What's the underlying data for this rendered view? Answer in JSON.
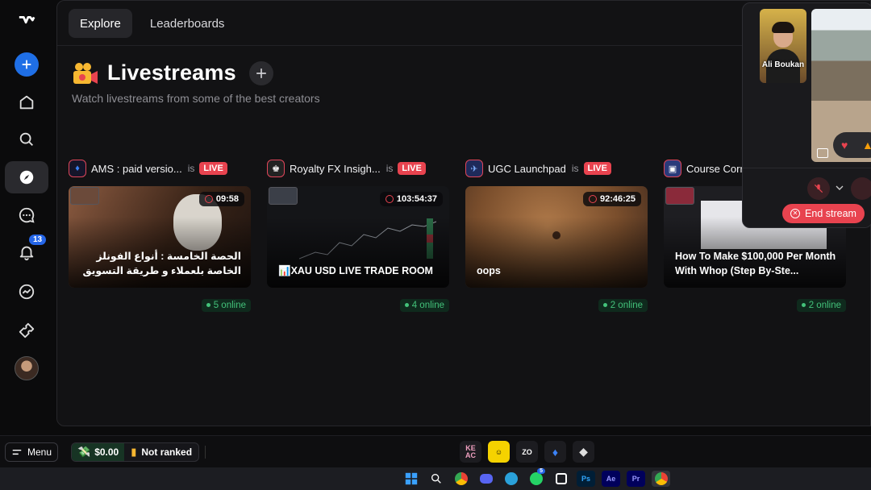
{
  "tabs": [
    {
      "label": "Explore",
      "active": true
    },
    {
      "label": "Leaderboards",
      "active": false
    }
  ],
  "sidebar": {
    "items": [
      "logo-icon",
      "create-icon",
      "home-icon",
      "search-icon",
      "explore-icon",
      "chat-icon",
      "notifications-icon",
      "analytics-icon",
      "tickets-icon",
      "profile-avatar"
    ],
    "notification_count": "13"
  },
  "header": {
    "title": "Livestreams",
    "subtitle": "Watch livestreams from some of the best creators"
  },
  "streams": [
    {
      "channel": "AMS : paid versio...",
      "is": "is",
      "live": "LIVE",
      "duration": "09:58",
      "title": "الحصة الخامسة : أنواع الفونلز الخاصة بلعملاء و طريقة التسويق",
      "online": "5 online",
      "accent": "#6a3f2e"
    },
    {
      "channel": "Royalty FX Insigh...",
      "is": "is",
      "live": "LIVE",
      "duration": "103:54:37",
      "title": "📊XAU USD LIVE TRADE ROOM",
      "online": "4 online",
      "accent": "#17181c"
    },
    {
      "channel": "UGC Launchpad",
      "is": "is",
      "live": "LIVE",
      "duration": "92:46:25",
      "title": "oops",
      "online": "2 online",
      "accent": "#a0622f"
    },
    {
      "channel": "Course Corr",
      "is": "",
      "live": "",
      "duration": "",
      "title": "How To Make $100,000 Per Month With Whop (Step By-Ste...",
      "online": "2 online",
      "accent": "#e6e6ea"
    }
  ],
  "float_panel": {
    "participant_name": "Ali Boukan",
    "end_stream_label": "End stream"
  },
  "bottombar": {
    "menu_label": "Menu",
    "balance": "$0.00",
    "rank": "Not ranked",
    "app_icons": [
      "KE AC",
      "yellow-app",
      "ZO",
      "blue-diamond",
      "ethereum"
    ]
  },
  "taskbar": {
    "icons": [
      "windows-icon",
      "search-icon",
      "chrome-icon",
      "discord-icon",
      "telegram-icon",
      "whatsapp-icon",
      "capcut-icon",
      "Ps",
      "Ae",
      "Pr",
      "chrome-icon"
    ],
    "whatsapp_badge": "5"
  },
  "colors": {
    "accent_blue": "#1f6fe6",
    "live_red": "#e8434f",
    "online_green": "#43c27a"
  }
}
